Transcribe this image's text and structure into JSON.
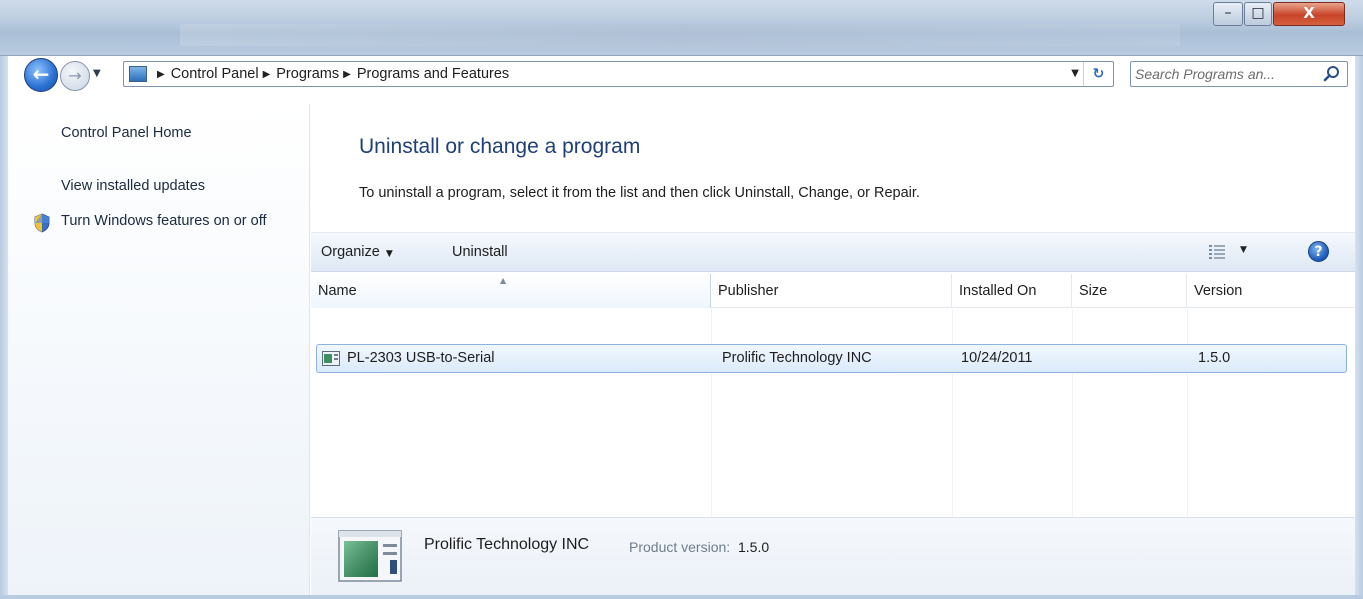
{
  "window": {
    "controls": {
      "minimize": "–",
      "maximize": "□",
      "close": "X"
    }
  },
  "navigation": {
    "back_glyph": "←",
    "forward_glyph": "→",
    "history_dropdown": "▼"
  },
  "address_bar": {
    "separator": "▶",
    "breadcrumbs": [
      "Control Panel",
      "Programs",
      "Programs and Features"
    ],
    "dropdown": "▼",
    "refresh_glyph": "↻"
  },
  "search": {
    "placeholder": "Search Programs an..."
  },
  "left_pane": {
    "links": {
      "home": "Control Panel Home",
      "updates": "View installed updates",
      "features": "Turn Windows features on or off"
    }
  },
  "main": {
    "title": "Uninstall or change a program",
    "description": "To uninstall a program, select it from the list and then click Uninstall, Change, or Repair.",
    "command_bar": {
      "organize": "Organize",
      "organize_arrow": "▼",
      "uninstall": "Uninstall",
      "views_dropdown": "▼",
      "help": "?"
    },
    "columns": {
      "name": "Name",
      "publisher": "Publisher",
      "installed_on": "Installed On",
      "size": "Size",
      "version": "Version",
      "sort_indicator": "▲"
    },
    "programs": [
      {
        "name": "PL-2303 USB-to-Serial",
        "publisher": "Prolific Technology INC",
        "installed_on": "10/24/2011",
        "size": "",
        "version": "1.5.0"
      }
    ],
    "details": {
      "publisher": "Prolific Technology INC",
      "version_label": "Product version:",
      "version_value": "1.5.0"
    }
  },
  "colors": {
    "title_blue": "#1e3f7a",
    "selection_fill": "#dbeafb",
    "selection_border": "#8db2e3",
    "close_button": "#c8442a"
  }
}
